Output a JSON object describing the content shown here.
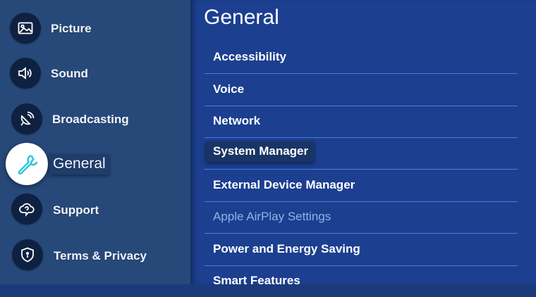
{
  "sidebar": {
    "items": [
      {
        "label": "Picture",
        "icon": "picture-icon"
      },
      {
        "label": "Sound",
        "icon": "sound-icon"
      },
      {
        "label": "Broadcasting",
        "icon": "broadcasting-icon"
      },
      {
        "label": "General",
        "icon": "wrench-icon",
        "selected": true
      },
      {
        "label": "Support",
        "icon": "support-cloud-icon"
      },
      {
        "label": "Terms & Privacy",
        "icon": "shield-icon"
      }
    ]
  },
  "main": {
    "title": "General",
    "items": [
      {
        "label": "Accessibility"
      },
      {
        "label": "Voice"
      },
      {
        "label": "Network"
      },
      {
        "label": "System Manager",
        "focused": true
      },
      {
        "label": "External Device Manager"
      },
      {
        "label": "Apple AirPlay Settings",
        "disabled": true
      },
      {
        "label": "Power and Energy Saving"
      },
      {
        "label": "Smart Features"
      }
    ]
  },
  "colors": {
    "sidebar_bg": "#27497a",
    "main_bg": "#1c3f90",
    "divider": "#4f7ed6",
    "disabled_text": "#8fb3e6",
    "selected_icon_bg": "#ffffff"
  }
}
